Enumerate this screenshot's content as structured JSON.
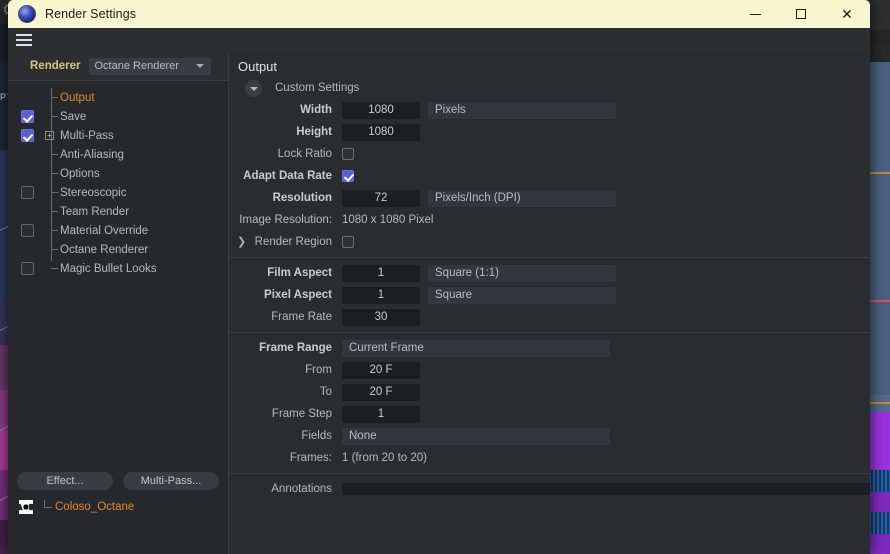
{
  "window": {
    "title": "Render Settings",
    "app_icon": "cinema4d-sphere-icon",
    "minimize": "–",
    "maximize": "□",
    "close": "✕"
  },
  "toolbar": {
    "menu_icon": "hamburger-icon"
  },
  "left": {
    "renderer_label": "Renderer",
    "renderer_value": "Octane Renderer",
    "tree": [
      {
        "label": "Output",
        "selected": true,
        "checkbox": "none",
        "expand": false
      },
      {
        "label": "Save",
        "selected": false,
        "checkbox": "checked",
        "expand": false
      },
      {
        "label": "Multi-Pass",
        "selected": false,
        "checkbox": "checked",
        "expand": true
      },
      {
        "label": "Anti-Aliasing",
        "selected": false,
        "checkbox": "none",
        "expand": false
      },
      {
        "label": "Options",
        "selected": false,
        "checkbox": "none",
        "expand": false
      },
      {
        "label": "Stereoscopic",
        "selected": false,
        "checkbox": "empty",
        "expand": false
      },
      {
        "label": "Team Render",
        "selected": false,
        "checkbox": "none",
        "expand": false
      },
      {
        "label": "Material Override",
        "selected": false,
        "checkbox": "empty",
        "expand": false
      },
      {
        "label": "Octane Renderer",
        "selected": false,
        "checkbox": "none",
        "expand": false
      },
      {
        "label": "Magic Bullet Looks",
        "selected": false,
        "checkbox": "empty",
        "expand": false
      }
    ],
    "effect_button": "Effect...",
    "multipass_button": "Multi-Pass...",
    "preset_name": "Coloso_Octane",
    "preset_icon": "render-setting-icon"
  },
  "output": {
    "heading": "Output",
    "preset_label": "Custom Settings",
    "width_label": "Width",
    "width_value": "1080",
    "width_unit": "Pixels",
    "height_label": "Height",
    "height_value": "1080",
    "lock_ratio_label": "Lock Ratio",
    "lock_ratio_checked": false,
    "adapt_data_rate_label": "Adapt Data Rate",
    "adapt_data_rate_checked": true,
    "resolution_label": "Resolution",
    "resolution_value": "72",
    "resolution_unit": "Pixels/Inch (DPI)",
    "image_resolution_label": "Image Resolution:",
    "image_resolution_value": "1080 x 1080 Pixel",
    "render_region_label": "Render Region",
    "render_region_checked": false,
    "film_aspect_label": "Film Aspect",
    "film_aspect_value": "1",
    "film_aspect_preset": "Square (1:1)",
    "pixel_aspect_label": "Pixel Aspect",
    "pixel_aspect_value": "1",
    "pixel_aspect_preset": "Square",
    "frame_rate_label": "Frame Rate",
    "frame_rate_value": "30",
    "frame_range_label": "Frame Range",
    "frame_range_value": "Current Frame",
    "from_label": "From",
    "from_value": "20 F",
    "to_label": "To",
    "to_value": "20 F",
    "frame_step_label": "Frame Step",
    "frame_step_value": "1",
    "fields_label": "Fields",
    "fields_value": "None",
    "frames_label": "Frames:",
    "frames_value": "1 (from 20 to 20)",
    "annotations_label": "Annotations",
    "annotations_value": ""
  },
  "colors": {
    "titlebar": "#f6f6cf",
    "panel": "#26282c",
    "panel_right": "#2a2c30",
    "accent_selected": "#e08a34",
    "accent_label": "#d8c87e",
    "checkbox_on": "#5b5fd0",
    "field_bg": "#1c1e21"
  }
}
